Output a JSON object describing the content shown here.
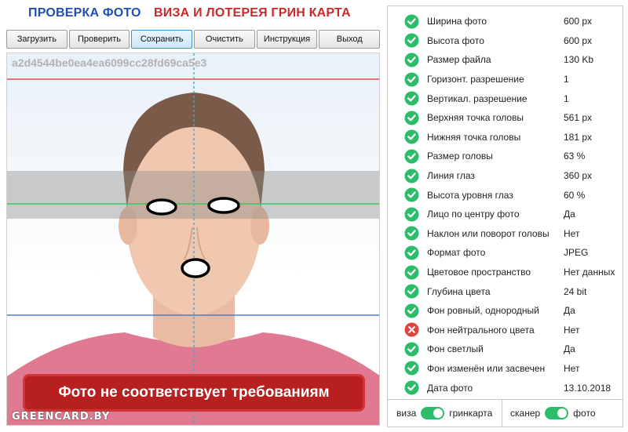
{
  "header": {
    "title_left": "ПРОВЕРКА ФОТО",
    "title_right": "ВИЗА И ЛОТЕРЕЯ ГРИН КАРТА"
  },
  "toolbar": {
    "buttons": [
      "Загрузить",
      "Проверить",
      "Сохранить",
      "Очистить",
      "Инструкция",
      "Выход"
    ],
    "active": "Сохранить"
  },
  "photo": {
    "hash": "a2d4544be0ea4ea6099cc28fd69ca5e3",
    "warning": "Фото не соответствует требованиям",
    "watermark": "GREENCARD.BY"
  },
  "checks": [
    {
      "label": "Ширина фото",
      "value": "600 px",
      "status": "ok"
    },
    {
      "label": "Высота фото",
      "value": "600 px",
      "status": "ok"
    },
    {
      "label": "Размер файла",
      "value": "130 Kb",
      "status": "ok"
    },
    {
      "label": "Горизонт. разрешение",
      "value": "1",
      "status": "ok"
    },
    {
      "label": "Вертикал. разрешение",
      "value": "1",
      "status": "ok"
    },
    {
      "label": "Верхняя точка головы",
      "value": "561 px",
      "status": "ok"
    },
    {
      "label": "Нижняя точка головы",
      "value": "181 px",
      "status": "ok"
    },
    {
      "label": "Размер головы",
      "value": "63 %",
      "status": "ok"
    },
    {
      "label": "Линия глаз",
      "value": "360 px",
      "status": "ok"
    },
    {
      "label": "Высота уровня глаз",
      "value": "60 %",
      "status": "ok"
    },
    {
      "label": "Лицо по центру фото",
      "value": "Да",
      "status": "ok"
    },
    {
      "label": "Наклон или поворот головы",
      "value": "Нет",
      "status": "ok"
    },
    {
      "label": "Формат фото",
      "value": "JPEG",
      "status": "ok"
    },
    {
      "label": "Цветовое пространство",
      "value": "Нет данных",
      "status": "ok"
    },
    {
      "label": "Глубина цвета",
      "value": "24 bit",
      "status": "ok"
    },
    {
      "label": "Фон ровный, однородный",
      "value": "Да",
      "status": "ok"
    },
    {
      "label": "Фон нейтрального цвета",
      "value": "Нет",
      "status": "fail"
    },
    {
      "label": "Фон светлый",
      "value": "Да",
      "status": "ok"
    },
    {
      "label": "Фон изменён или засвечен",
      "value": "Нет",
      "status": "ok"
    },
    {
      "label": "Дата фото",
      "value": "13.10.2018",
      "status": "ok"
    }
  ],
  "toggles": {
    "mode": {
      "left": "виза",
      "right": "гринкарта",
      "state": "on"
    },
    "source": {
      "left": "сканер",
      "right": "фото",
      "state": "on"
    }
  },
  "colors": {
    "ok": "#2dbd6a",
    "fail": "#e0443e",
    "title_blue": "#1f4fb0",
    "title_red": "#c62a2a",
    "warning_bg": "#b81f1f",
    "guide_red": "#d9534f",
    "guide_green": "#3cc45a",
    "guide_blue": "#4a7fc8"
  },
  "icons": {
    "ok": "check-circle-icon",
    "fail": "cross-circle-icon"
  }
}
